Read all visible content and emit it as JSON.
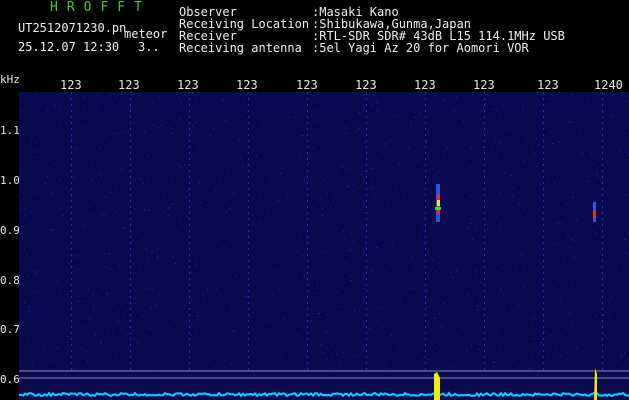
{
  "header": {
    "brand": "HROFFT",
    "filename": "UT2512071230.pn",
    "mode": "meteor",
    "datetime": "25.12.07 12:30",
    "count": "3..",
    "info_labels": [
      "Observer",
      "Receiving Location",
      "Receiver",
      "Receiving antenna"
    ],
    "info_values": [
      ":Masaki Kano",
      ":Shibukawa,Gunma,Japan",
      ":RTL-SDR SDR# 43dB L15 114.1MHz USB",
      ":5el Yagi Az 20 for Aomori VOR"
    ]
  },
  "spectrogram": {
    "unit": "kHz",
    "time_ticks": [
      "123",
      "123",
      "123",
      "123",
      "123",
      "123",
      "123",
      "123",
      "123",
      "1240"
    ],
    "freq_ticks": [
      "1.1",
      "1.0",
      "0.9",
      "0.8",
      "0.7",
      "0.6"
    ],
    "colors": {
      "background": "#0a0a50",
      "grid": "#1c1c9a",
      "trace": "#00d8ff",
      "highlight": "#f2ee00"
    }
  }
}
